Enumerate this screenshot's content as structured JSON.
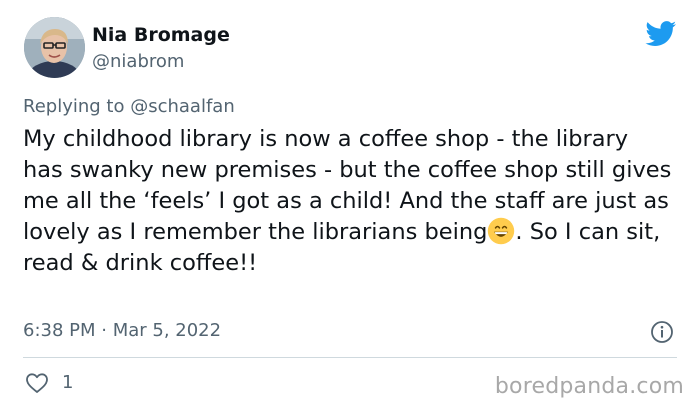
{
  "author": {
    "display_name": "Nia Bromage",
    "handle": "@niabrom",
    "avatar_icon": "user-avatar-photo"
  },
  "brand": {
    "icon": "twitter-bird-icon",
    "color": "#1d9bf0"
  },
  "reply": {
    "prefix": "Replying to",
    "mention": "@schaalfan"
  },
  "tweet": {
    "text_part1": "My childhood library is now a coffee shop - the library has swanky new premises - but the coffee shop still gives me all the ‘feels’ I got as a child! And the staff are just as lovely as I remember the librarians being",
    "emoji": "grinning-face-emoji",
    "text_part2": ". So I can sit, read & drink coffee!!"
  },
  "meta": {
    "timestamp": "6:38 PM · Mar 5, 2022",
    "info_icon": "info-icon"
  },
  "actions": {
    "like_icon": "heart-icon",
    "like_count": "1"
  },
  "watermark": {
    "text": "boredpanda.com"
  },
  "colors": {
    "text": "#0f1419",
    "secondary": "#536471",
    "divider": "#cfd9de",
    "watermark": "#a8a8a8"
  }
}
